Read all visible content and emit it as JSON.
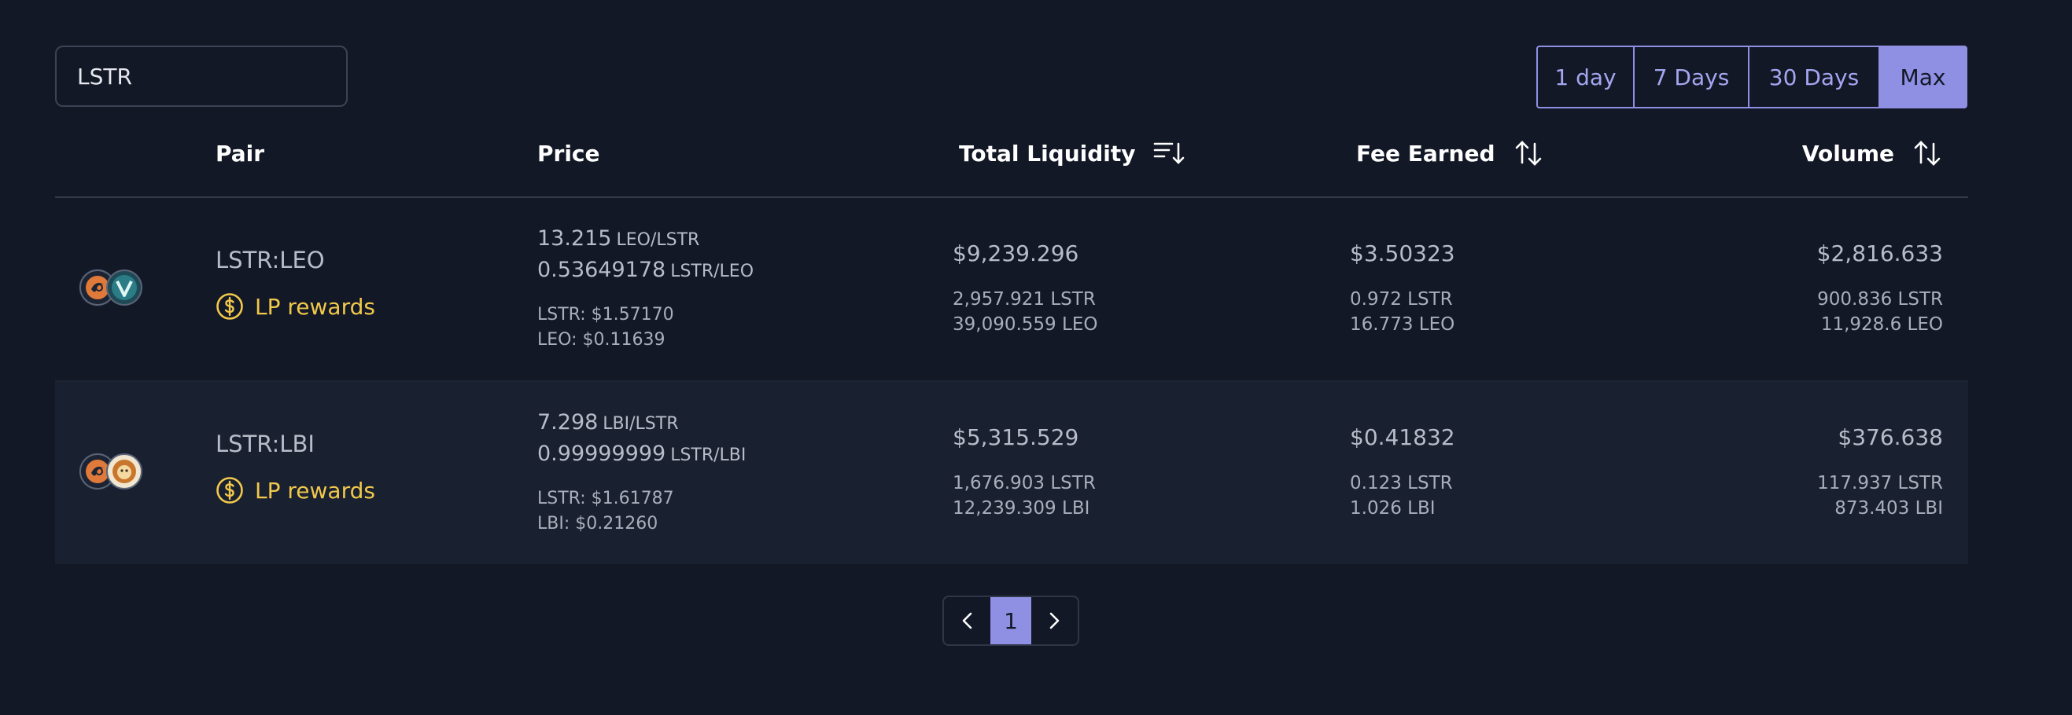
{
  "search": {
    "value": "LSTR"
  },
  "periods": [
    "1 day",
    "7 Days",
    "30 Days",
    "Max"
  ],
  "columns": {
    "pair": "Pair",
    "price": "Price",
    "liquidity": "Total Liquidity",
    "fee": "Fee Earned",
    "volume": "Volume"
  },
  "rows": [
    {
      "pair": "LSTR:LEO",
      "lp": "LP rewards",
      "price1": "13.215",
      "price1_unit": "LEO/LSTR",
      "price2": "0.53649178",
      "price2_unit": "LSTR/LEO",
      "usd1": "LSTR: $1.57170",
      "usd2": "LEO: $0.11639",
      "liq": "$9,239.296",
      "liq1": "2,957.921 LSTR",
      "liq2": "39,090.559 LEO",
      "fee": "$3.50323",
      "fee1": "0.972 LSTR",
      "fee2": "16.773 LEO",
      "vol": "$2,816.633",
      "vol1": "900.836 LSTR",
      "vol2": "11,928.6 LEO"
    },
    {
      "pair": "LSTR:LBI",
      "lp": "LP rewards",
      "price1": "7.298",
      "price1_unit": "LBI/LSTR",
      "price2": "0.99999999",
      "price2_unit": "LSTR/LBI",
      "usd1": "LSTR: $1.61787",
      "usd2": "LBI: $0.21260",
      "liq": "$5,315.529",
      "liq1": "1,676.903 LSTR",
      "liq2": "12,239.309 LBI",
      "fee": "$0.41832",
      "fee1": "0.123 LSTR",
      "fee2": "1.026 LBI",
      "vol": "$376.638",
      "vol1": "117.937 LSTR",
      "vol2": "873.403 LBI"
    }
  ],
  "pagination": {
    "current": "1"
  },
  "colors": {
    "accent": "#8f90e3",
    "reward": "#f2c84b",
    "bg": "#121826"
  }
}
